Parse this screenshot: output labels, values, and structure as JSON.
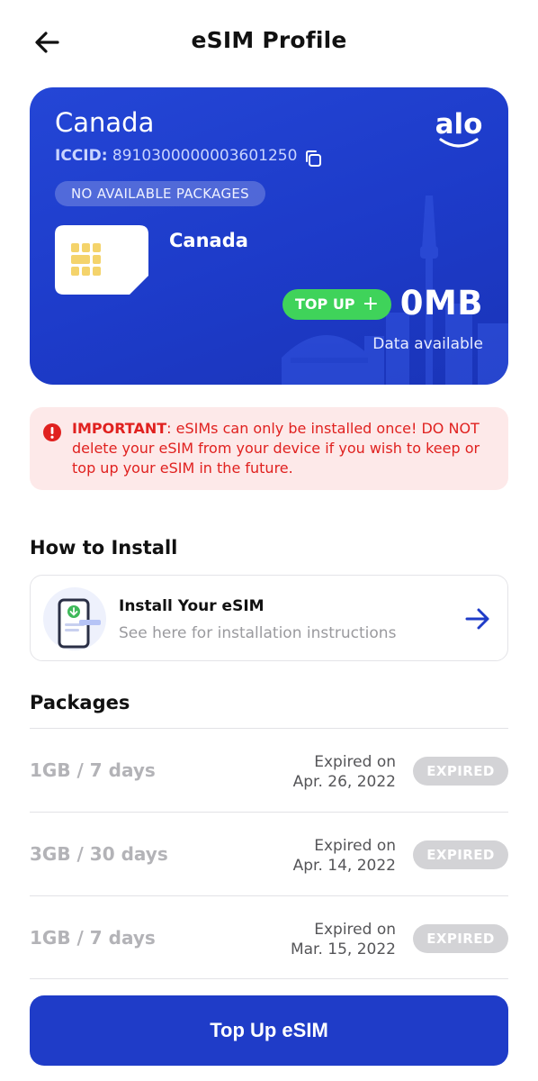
{
  "header": {
    "title": "eSIM Profile",
    "back_icon": "arrow-left-icon"
  },
  "card": {
    "country": "Canada",
    "logo": "alo",
    "iccid_label": "ICCID:",
    "iccid_value": "8910300000003601250",
    "status_badge": "NO AVAILABLE PACKAGES",
    "sim_country": "Canada",
    "topup_label": "TOP UP",
    "topup_plus": "+",
    "data_amount": "0MB",
    "data_caption": "Data available",
    "colors": {
      "card_bg": "#1f3cc8",
      "topup_pill": "#3fd35a",
      "chip": "#f4d36b"
    }
  },
  "notice": {
    "strong": "IMPORTANT",
    "text": ": eSIMs can only be installed once! DO NOT delete your eSIM from your device if you wish to keep or top up your eSIM in the future.",
    "color": "#e0211f"
  },
  "install": {
    "section_title": "How to Install",
    "title": "Install Your eSIM",
    "subtitle": "See here for installation instructions"
  },
  "packages": {
    "section_title": "Packages",
    "items": [
      {
        "name": "1GB / 7 days",
        "expired_label": "Expired on",
        "date": "Apr. 26, 2022",
        "status": "EXPIRED"
      },
      {
        "name": "3GB / 30 days",
        "expired_label": "Expired on",
        "date": "Apr. 14, 2022",
        "status": "EXPIRED"
      },
      {
        "name": "1GB / 7 days",
        "expired_label": "Expired on",
        "date": "Mar. 15, 2022",
        "status": "EXPIRED"
      }
    ]
  },
  "footer": {
    "button_label": "Top Up eSIM",
    "color": "#1f3cc8"
  }
}
